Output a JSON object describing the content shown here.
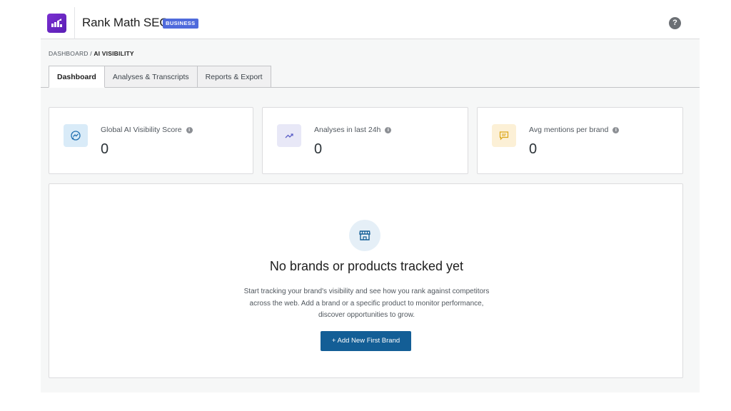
{
  "header": {
    "app_name": "Rank Math SEO",
    "plan_badge": "BUSINESS",
    "help_icon": "question-circle-icon",
    "logo_icon": "rank-math-logo-icon"
  },
  "breadcrumb": {
    "root": "DASHBOARD",
    "separator": "/",
    "current": "AI VISIBILITY"
  },
  "tabs": [
    {
      "label": "Dashboard",
      "active": true
    },
    {
      "label": "Analyses & Transcripts",
      "active": false
    },
    {
      "label": "Reports & Export",
      "active": false
    }
  ],
  "stats": [
    {
      "label": "Global AI Visibility Score",
      "value": "0",
      "icon": "visibility-chart-icon",
      "color": "#d9ebf8"
    },
    {
      "label": "Analyses in last 24h",
      "value": "0",
      "icon": "trend-up-icon",
      "color": "#e8e8f7"
    },
    {
      "label": "Avg mentions per brand",
      "value": "0",
      "icon": "chat-message-icon",
      "color": "#fcf0d6"
    }
  ],
  "empty_state": {
    "icon": "storefront-icon",
    "title": "No brands or products tracked yet",
    "description_lines": [
      "Start tracking your brand's visibility and see how you rank against competitors",
      "across the web. Add a brand or a specific product to monitor performance,",
      "discover opportunities to grow."
    ],
    "button_label": "+ Add New First Brand"
  },
  "colors": {
    "accent": "#135e96",
    "badge": "#4f6bdc",
    "logo": "#6a26c8"
  }
}
